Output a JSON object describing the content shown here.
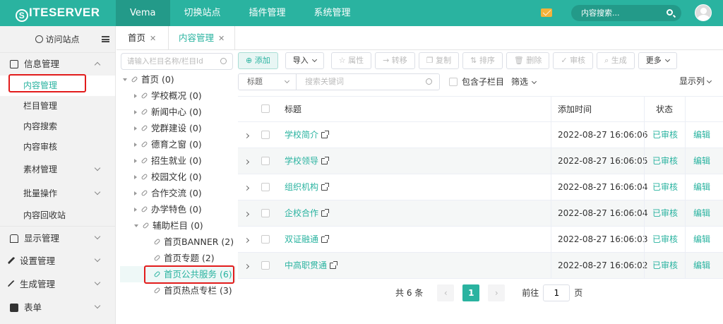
{
  "brand": {
    "logo_text": "ITESERVER",
    "logo_letter": "S"
  },
  "topnav": [
    {
      "label": "Vema"
    },
    {
      "label": "切换站点"
    },
    {
      "label": "插件管理"
    },
    {
      "label": "系统管理"
    }
  ],
  "top_search": {
    "placeholder": "内容搜索..."
  },
  "sidebar": {
    "visit_label": "访问站点",
    "menus": {
      "info": "信息管理",
      "content_manage": "内容管理",
      "channel_manage": "栏目管理",
      "content_search": "内容搜索",
      "content_review": "内容审核",
      "material": "素材管理",
      "batch": "批量操作",
      "recycle": "内容回收站",
      "display": "显示管理",
      "settings": "设置管理",
      "generate": "生成管理",
      "forms": "表单"
    }
  },
  "tabs": [
    {
      "label": "首页",
      "close": "✕"
    },
    {
      "label": "内容管理",
      "close": "✕"
    }
  ],
  "tree": {
    "search_placeholder": "请输入栏目名称/栏目Id",
    "nodes": [
      {
        "label": "首页 (0)"
      },
      {
        "label": "学校概况 (0)"
      },
      {
        "label": "新闻中心 (0)"
      },
      {
        "label": "党群建设 (0)"
      },
      {
        "label": "德育之窗 (0)"
      },
      {
        "label": "招生就业 (0)"
      },
      {
        "label": "校园文化 (0)"
      },
      {
        "label": "合作交流 (0)"
      },
      {
        "label": "办学特色 (0)"
      },
      {
        "label": "辅助栏目 (0)"
      },
      {
        "label": "首页BANNER (2)"
      },
      {
        "label": "首页专题 (2)"
      },
      {
        "label": "首页公共服务 (6)"
      },
      {
        "label": "首页热点专栏 (3)"
      }
    ]
  },
  "toolbar": {
    "add": "添加",
    "import": "导入",
    "attrs": "属性",
    "transfer": "转移",
    "copy": "复制",
    "sort": "排序",
    "delete": "删除",
    "review": "审核",
    "generate": "生成",
    "more": "更多"
  },
  "filter": {
    "field": "标题",
    "keyword_placeholder": "搜索关键词",
    "include_sub": "包含子栏目",
    "screen": "筛选",
    "columns": "显示列"
  },
  "table": {
    "headers": {
      "title": "标题",
      "time": "添加时间",
      "status": "状态"
    },
    "rows": [
      {
        "title": "学校简介",
        "time": "2022-08-27 16:06:06",
        "status": "已审核",
        "op": "编辑"
      },
      {
        "title": "学校领导",
        "time": "2022-08-27 16:06:05",
        "status": "已审核",
        "op": "编辑"
      },
      {
        "title": "组织机构",
        "time": "2022-08-27 16:06:04",
        "status": "已审核",
        "op": "编辑"
      },
      {
        "title": "企校合作",
        "time": "2022-08-27 16:06:04",
        "status": "已审核",
        "op": "编辑"
      },
      {
        "title": "双证融通",
        "time": "2022-08-27 16:06:03",
        "status": "已审核",
        "op": "编辑"
      },
      {
        "title": "中高职贯通",
        "time": "2022-08-27 16:06:02",
        "status": "已审核",
        "op": "编辑"
      }
    ]
  },
  "pager": {
    "total": "共 6 条",
    "prev": "‹",
    "current": "1",
    "next": "›",
    "goto_label": "前往",
    "goto_value": "1",
    "page_unit": "页"
  },
  "colors": {
    "accent": "#2ab3a0",
    "highlight": "#e21c1c"
  }
}
